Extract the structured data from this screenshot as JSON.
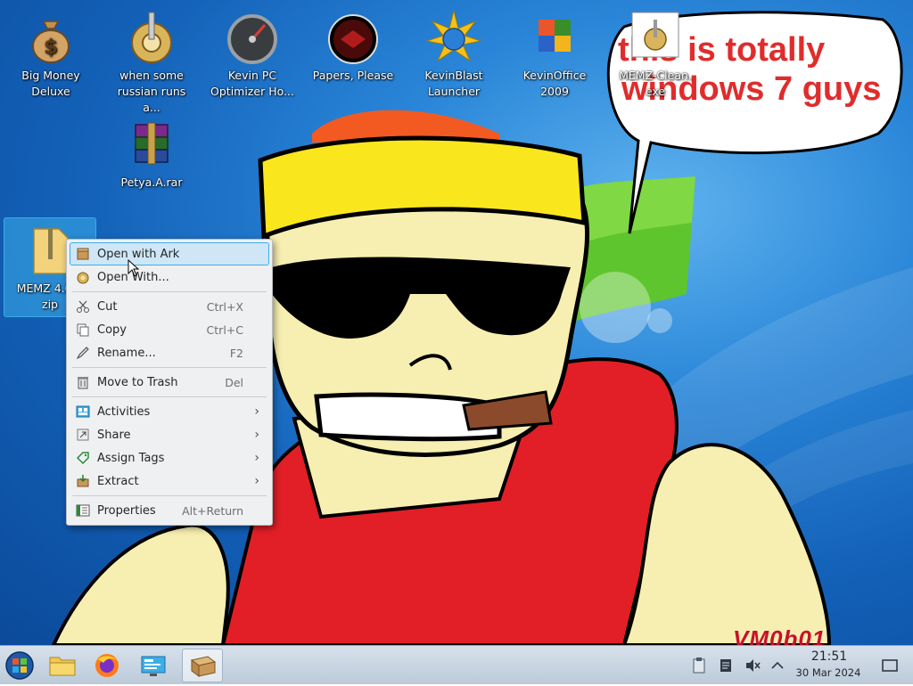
{
  "desktop": {
    "icons": [
      {
        "label": "Big Money\nDeluxe"
      },
      {
        "label": "when some\nrussian runs a..."
      },
      {
        "label": "Kevin PC\nOptimizer Ho..."
      },
      {
        "label": "Papers, Please"
      },
      {
        "label": "KevinBlast\nLauncher"
      },
      {
        "label": "KevinOffice\n2009"
      },
      {
        "label": "MEMZ-Clean.\nexe"
      },
      {
        "label": "Petya.A.rar"
      },
      {
        "label": "MEMZ 4.0 C\nzip"
      }
    ],
    "bubble": {
      "line1": "this is totally",
      "line2": "windows 7 guys"
    },
    "watermark": "VM0b01"
  },
  "context_menu": {
    "items": [
      {
        "label": "Open with Ark",
        "shortcut": "",
        "icon": "ark-icon"
      },
      {
        "label": "Open With...",
        "shortcut": "",
        "icon": "open-with-icon"
      },
      {
        "label": "Cut",
        "shortcut": "Ctrl+X",
        "icon": "scissors-icon"
      },
      {
        "label": "Copy",
        "shortcut": "Ctrl+C",
        "icon": "copy-icon"
      },
      {
        "label": "Rename...",
        "shortcut": "F2",
        "icon": "rename-icon"
      },
      {
        "label": "Move to Trash",
        "shortcut": "Del",
        "icon": "trash-icon"
      },
      {
        "label": "Activities",
        "shortcut": "",
        "icon": "activities-icon",
        "submenu": true
      },
      {
        "label": "Share",
        "shortcut": "",
        "icon": "share-icon",
        "submenu": true
      },
      {
        "label": "Assign Tags",
        "shortcut": "",
        "icon": "tag-icon",
        "submenu": true
      },
      {
        "label": "Extract",
        "shortcut": "",
        "icon": "extract-icon",
        "submenu": true
      },
      {
        "label": "Properties",
        "shortcut": "Alt+Return",
        "icon": "properties-icon"
      }
    ],
    "submenu_arrow": "›"
  },
  "taskbar": {
    "clock": {
      "time": "21:51",
      "date": "30 Mar 2024"
    }
  },
  "colors": {
    "selection": "#3daee9",
    "bubble_text": "#e02c2c",
    "menu_bg": "#eff0f1"
  }
}
